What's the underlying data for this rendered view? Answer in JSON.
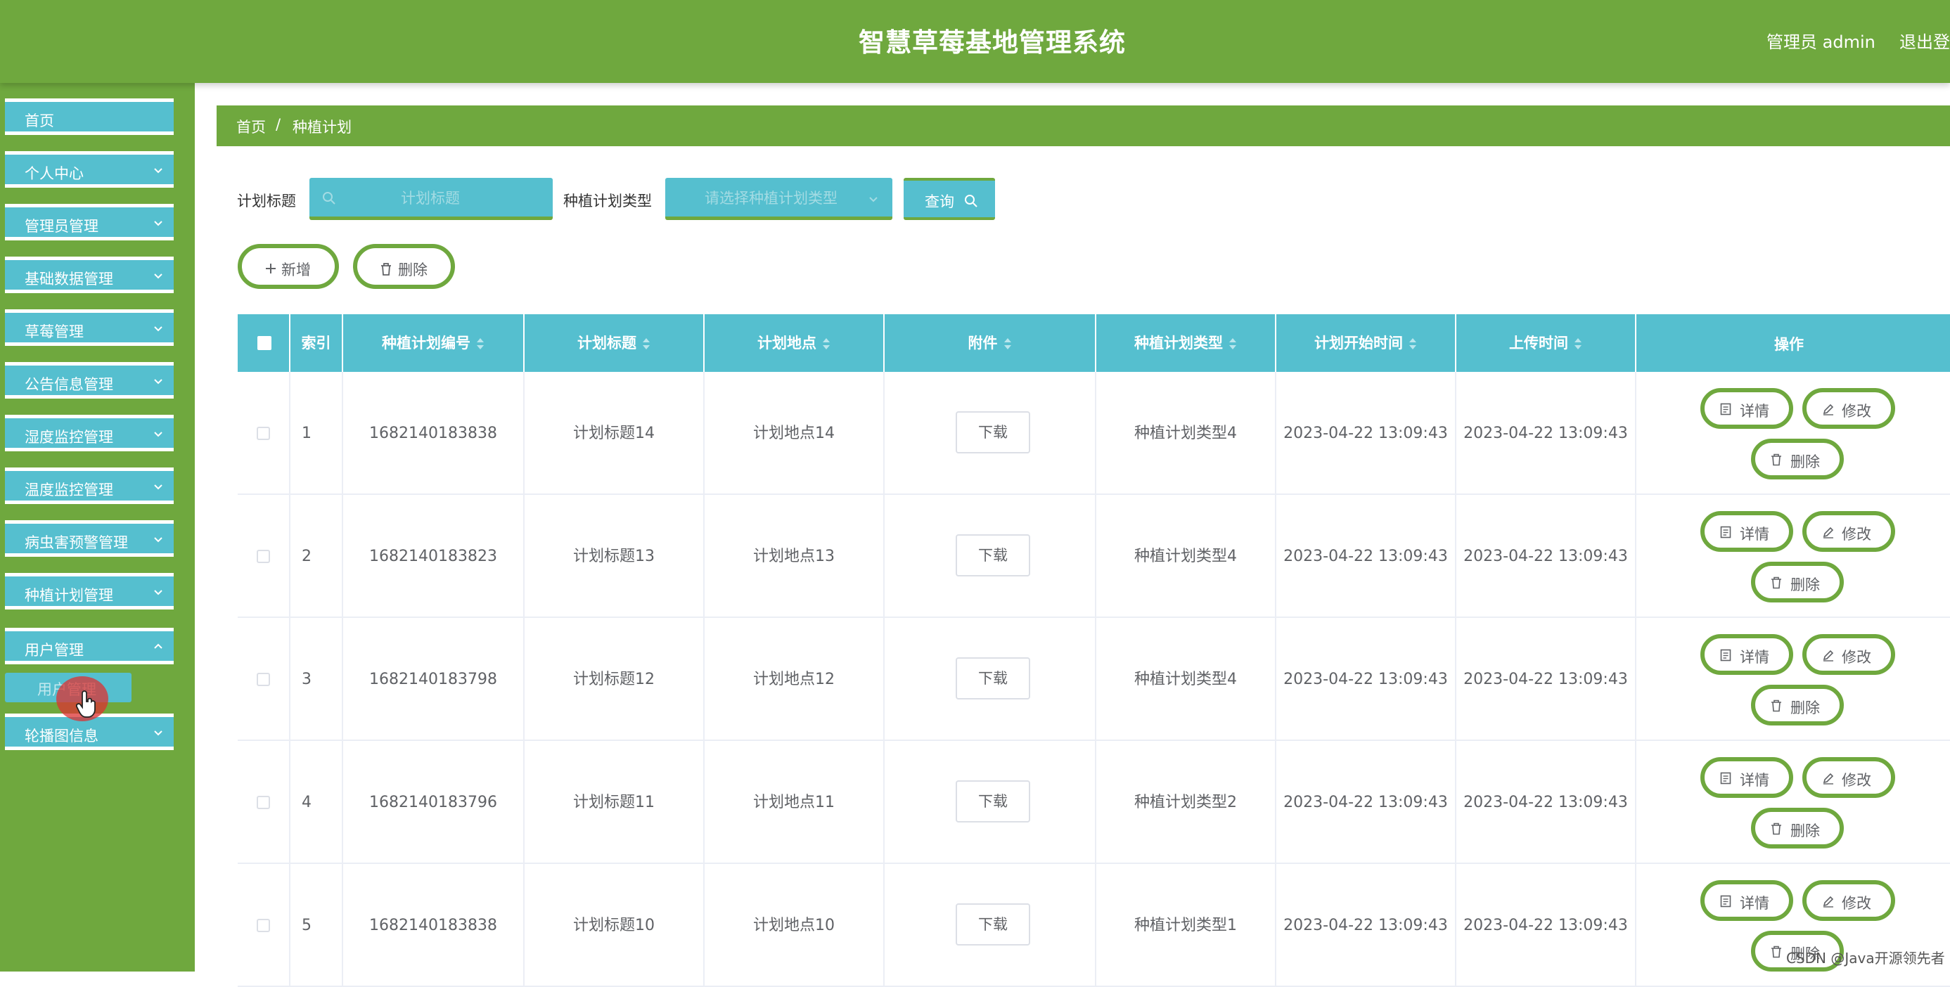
{
  "header": {
    "title": "智慧草莓基地管理系统",
    "user": "管理员 admin",
    "logout": "退出登"
  },
  "sidebar": {
    "items": [
      {
        "label": "首页"
      },
      {
        "label": "个人中心"
      },
      {
        "label": "管理员管理"
      },
      {
        "label": "基础数据管理"
      },
      {
        "label": "草莓管理"
      },
      {
        "label": "公告信息管理"
      },
      {
        "label": "湿度监控管理"
      },
      {
        "label": "温度监控管理"
      },
      {
        "label": "病虫害预警管理"
      },
      {
        "label": "种植计划管理"
      },
      {
        "label": "用户管理"
      },
      {
        "label": "轮播图信息"
      }
    ],
    "submenu_label": "用户管理"
  },
  "breadcrumb": {
    "home": "首页",
    "separator": "/",
    "current": "种植计划"
  },
  "search": {
    "title_label": "计划标题",
    "title_placeholder": "计划标题",
    "type_label": "种植计划类型",
    "type_placeholder": "请选择种植计划类型",
    "query_label": "查询"
  },
  "actions": {
    "add_label": "新增",
    "delete_label": "删除"
  },
  "table": {
    "columns": [
      "索引",
      "种植计划编号",
      "计划标题",
      "计划地点",
      "附件",
      "种植计划类型",
      "计划开始时间",
      "上传时间",
      "操作"
    ],
    "download_label": "下载",
    "detail_label": "详情",
    "edit_label": "修改",
    "delete_label": "删除",
    "rows": [
      {
        "index": "1",
        "code": "1682140183838",
        "title": "计划标题14",
        "place": "计划地点14",
        "type": "种植计划类型4",
        "start": "2023-04-22 13:09:43",
        "upload": "2023-04-22 13:09:43"
      },
      {
        "index": "2",
        "code": "1682140183823",
        "title": "计划标题13",
        "place": "计划地点13",
        "type": "种植计划类型4",
        "start": "2023-04-22 13:09:43",
        "upload": "2023-04-22 13:09:43"
      },
      {
        "index": "3",
        "code": "1682140183798",
        "title": "计划标题12",
        "place": "计划地点12",
        "type": "种植计划类型4",
        "start": "2023-04-22 13:09:43",
        "upload": "2023-04-22 13:09:43"
      },
      {
        "index": "4",
        "code": "1682140183796",
        "title": "计划标题11",
        "place": "计划地点11",
        "type": "种植计划类型2",
        "start": "2023-04-22 13:09:43",
        "upload": "2023-04-22 13:09:43"
      },
      {
        "index": "5",
        "code": "1682140183838",
        "title": "计划标题10",
        "place": "计划地点10",
        "type": "种植计划类型1",
        "start": "2023-04-22 13:09:43",
        "upload": "2023-04-22 13:09:43"
      }
    ]
  },
  "watermark": "CSDN @Java开源领先者",
  "colors": {
    "green": "#6fa83e",
    "cyan": "#55bfcf"
  }
}
